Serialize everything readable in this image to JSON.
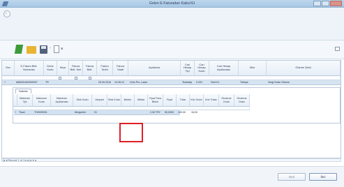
{
  "window": {
    "title": "Gelen E-Faturadan Kabul Et"
  },
  "toolbar": {
    "sep1": "-",
    "pin_arrow": "▾"
  },
  "grid": {
    "columns": [
      "Sec",
      "E-Fatura Belt. Numarası",
      "Döviz Kodu",
      "Seçe",
      "Fatura Belt. Seri",
      "Fatura Belt.",
      "Fatura Tarihi",
      "Fatura Saati",
      "Açıklama",
      "Cari Hesap Tipi",
      "Cari Hesap Kodu",
      "Cari Hesap Açıklaması",
      "Ülke",
      "Ödeme Şekli"
    ],
    "rows": [
      {
        "expand": "+",
        "efatura_no": "AB8201600000007",
        "doviz": "TR",
        "date": "25.09.2016",
        "time": "10:45:12",
        "aciklama": "Ürün Pro. Laser",
        "cari_tip": "Tedarikçi",
        "cari_kod": "2-031",
        "cari_aciklama": "Özel KL",
        "ulke": "Türkiye",
        "odeme": "Vergi Kesin Ödeme"
      }
    ],
    "pager": "|◂ ◂ Record 1 of 1 ▸ ▸| ▸ ▾ ◂"
  },
  "subgrid": {
    "tab": "Satırlar",
    "columns": [
      "Malzeme Tipi",
      "Malzeme Kodu",
      "Malzeme Açıklaması",
      "Stok Kodu",
      "Varyant",
      "Stok Kodu",
      "Beden",
      "Miktar",
      "Fiyat Para Birimi",
      "Fiyat",
      "Tutar",
      "Kdv Oranı",
      "Kdv Tutarı",
      "Öndeme Kodu",
      "Öndeme Oranı"
    ],
    "rows": [
      {
        "expand": "+",
        "tip": "Ticari",
        "kod": "TH0000001",
        "stok": "Mergenler",
        "varyant": "01",
        "fiyat_birim": "2,00 TRY",
        "fiyat": "50,0000",
        "tutar": "100,00",
        "kdv": "18,00"
      }
    ]
  },
  "footer": {
    "back_label": "Geri",
    "next_label": "İleri"
  },
  "colors": {
    "highlight": "#e01e25",
    "selected_row": "#d6e3f1",
    "header": "#e6eef7"
  }
}
